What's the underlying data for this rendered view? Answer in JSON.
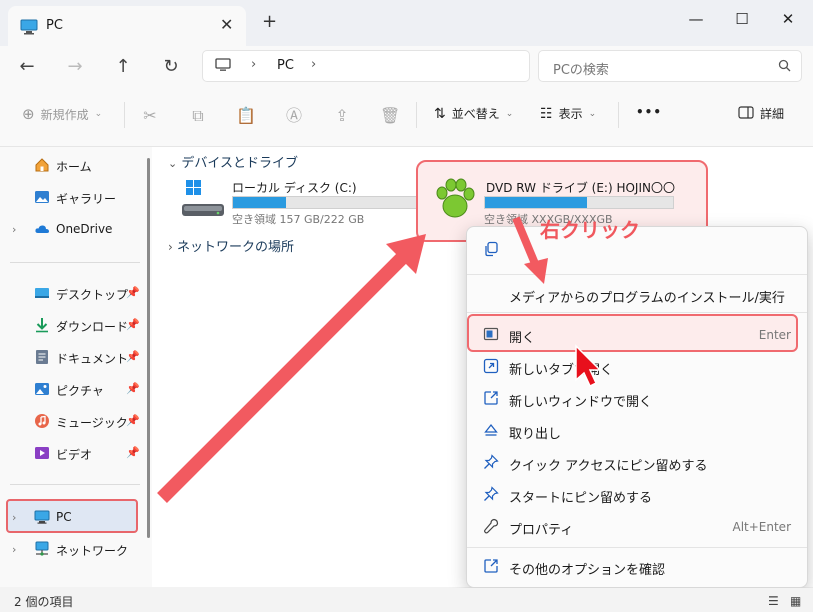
{
  "window": {
    "tab_title": "PC",
    "new_tab": "+",
    "controls": {
      "minimize": "—",
      "maximize": "☐",
      "close": "✕"
    }
  },
  "nav": {
    "back": "←",
    "forward": "→",
    "up": "↑",
    "refresh": "↻",
    "breadcrumb": [
      "PC"
    ],
    "search_placeholder": "PCの検索"
  },
  "toolbar": {
    "new_label": "新規作成",
    "sort_label": "並べ替え",
    "view_label": "表示",
    "more_label": "•••",
    "details_label": "詳細"
  },
  "sidebar": {
    "items": [
      {
        "label": "ホーム",
        "icon": "home-icon"
      },
      {
        "label": "ギャラリー",
        "icon": "gallery-icon"
      },
      {
        "label": "OneDrive",
        "icon": "cloud-icon"
      },
      {
        "label": "デスクトップ",
        "icon": "desktop-icon"
      },
      {
        "label": "ダウンロード",
        "icon": "download-icon"
      },
      {
        "label": "ドキュメント",
        "icon": "document-icon"
      },
      {
        "label": "ピクチャ",
        "icon": "picture-icon"
      },
      {
        "label": "ミュージック",
        "icon": "music-icon"
      },
      {
        "label": "ビデオ",
        "icon": "video-icon"
      },
      {
        "label": "PC",
        "icon": "monitor-icon"
      },
      {
        "label": "ネットワーク",
        "icon": "network-icon"
      }
    ]
  },
  "content": {
    "group_devices": "デバイスとドライブ",
    "group_network": "ネットワークの場所",
    "drives": [
      {
        "name": "ローカル ディスク (C:)",
        "space": "空き領域 157 GB/222 GB",
        "used_fraction": 0.29
      },
      {
        "name": "DVD RW ドライブ (E:) HOJIN〇〇",
        "space": "空き領域 XXXGB/XXXGB",
        "used_fraction": 0.54
      }
    ]
  },
  "annotation": {
    "right_click": "右クリック"
  },
  "context_menu": {
    "items": [
      {
        "label": "メディアからのプログラムのインストール/実行",
        "shortcut": "",
        "icon": ""
      },
      {
        "label": "開く",
        "shortcut": "Enter",
        "icon": "open-icon"
      },
      {
        "label": "新しいタブで開く",
        "shortcut": "",
        "icon": "new-tab-icon"
      },
      {
        "label": "新しいウィンドウで開く",
        "shortcut": "",
        "icon": "new-window-icon"
      },
      {
        "label": "取り出し",
        "shortcut": "",
        "icon": "eject-icon"
      },
      {
        "label": "クイック アクセスにピン留めする",
        "shortcut": "",
        "icon": "pin-icon"
      },
      {
        "label": "スタートにピン留めする",
        "shortcut": "",
        "icon": "pin-icon"
      },
      {
        "label": "プロパティ",
        "shortcut": "Alt+Enter",
        "icon": "wrench-icon"
      },
      {
        "label": "その他のオプションを確認",
        "shortcut": "",
        "icon": "share-icon"
      }
    ]
  },
  "status": {
    "item_count": "2 個の項目"
  },
  "colors": {
    "accent": "#2b9be0",
    "highlight_border": "#f06a6f",
    "highlight_fill": "#fdecec",
    "arrow": "#f25a60",
    "dvd_icon": "#7cc832"
  }
}
